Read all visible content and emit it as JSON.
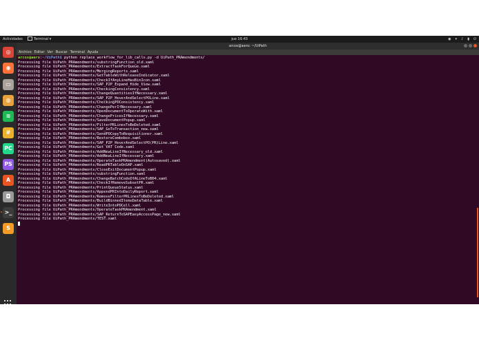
{
  "topbar": {
    "activities": "Actividades",
    "app_name": "Terminal",
    "app_menu_arrow": "▾",
    "clock": "jue 16:43",
    "status_icons": [
      "chrome-icon",
      "wifi-icon",
      "volume-icon",
      "battery-icon",
      "power-icon"
    ],
    "status_glyphs": [
      "◉",
      "▾",
      "♪",
      "▮",
      "⏻"
    ]
  },
  "window": {
    "title": "arcos@aero: ~/UiPath",
    "menu": [
      "Archivo",
      "Editar",
      "Ver",
      "Buscar",
      "Terminal",
      "Ayuda"
    ]
  },
  "terminal": {
    "prompt_user": "arcos@aero",
    "prompt_path": ":~/UiPath$",
    "command": " python replace_workflow_for_lib_calls.py -d UiPath_PRAmendments/",
    "lines": [
      "Processing file UiPath_PRAmendments/substringFunction_old.xaml",
      "Processing file UiPath_PRAmendments/ExtractTaskForQueue.xaml",
      "Processing file UiPath_PRAmendments/MergingReports.xaml",
      "Processing file UiPath_PRAmendments/GetTableWithReleaseIndicator.xaml",
      "Processing file UiPath_PRAmendments/CheckIfAnyLineHasBinIcon.xaml",
      "Processing file UiPath_PRAmendments/SAP_P2P_Expand_Hide_View.xaml",
      "Processing file UiPath_PRAmendments/CheckingConsistency.xaml",
      "Processing file UiPath_PRAmendments/ChangeQuantitiesIfNecessary.xaml",
      "Processing file UiPath_PRAmendments/SAP_P2P_HoverAndSelectPOLine.xaml",
      "Processing file UiPath_PRAmendments/CheckingPOConsistency.xaml",
      "Processing file UiPath_PRAmendments/ChangePerIfNecessary.xaml",
      "Processing file UiPath_PRAmendments/OpenDocumentToOperateWith.xaml",
      "Processing file UiPath_PRAmendments/ChangePricesIfNecessary.xaml",
      "Processing file UiPath_PRAmendments/SaveDocumentPopup.xaml",
      "Processing file UiPath_PRAmendments/FilterPRLinesToBeDeleted.xaml",
      "Processing file UiPath_PRAmendments/SAP_GoToTransaction_new.xaml",
      "Processing file UiPath_PRAmendments/SendPOCopyToRequisitioner.xaml",
      "Processing file UiPath_PRAmendments/RestoreCombobox.xaml",
      "Processing file UiPath_PRAmendments/SAP_P2P_HoverAndSelectPO(PR)Line.xaml",
      "Processing file UiPath_PRAmendments/Get VAT Code.xaml",
      "Processing file UiPath_PRAmendments/AddNewLineIfNecessary_old.xaml",
      "Processing file UiPath_PRAmendments/AddNewLineIfNecessary.xaml",
      "Processing file UiPath_PRAmendments/OperateTaskPRAmendment(Autosaved).xaml",
      "Processing file UiPath_PRAmendments/ReadPRTableOnSAP.xaml",
      "Processing file UiPath_PRAmendments/CloseExitDocumentPopup.xaml",
      "Processing file UiPath_PRAmendments/substringFunction.xaml",
      "Processing file UiPath_PRAmendments/ChangeBatchCodeOfALineToB04.xaml",
      "Processing file UiPath_PRAmendments/CheckIfRemoveSubsetPR.xaml",
      "Processing file UiPath_PRAmendments/PrintQueueStatus.xaml",
      "Processing file UiPath_PRAmendments/AppendPRIntoDailyReport.xaml",
      "Processing file UiPath_PRAmendments/RemoveFilterPRLinesToBeDeleted.xaml",
      "Processing file UiPath_PRAmendments/BuildBinnedItemsDataTable.xaml",
      "Processing file UiPath_PRAmendments/WriteIntoPOCell.xaml",
      "Processing file UiPath_PRAmendments/OperateTaskPRAmendment.xaml",
      "Processing file UiPath_PRAmendments/SAP_ReturnToSAPEasyAccessPage_new.xaml",
      "Processing file UiPath_PRAmendments/TEST.xaml"
    ]
  },
  "dock": [
    {
      "name": "chrome-icon",
      "glyph": "◎",
      "color": "#db4437"
    },
    {
      "name": "firefox-icon",
      "glyph": "◉",
      "color": "#ff7139"
    },
    {
      "name": "files-icon",
      "glyph": "▭",
      "color": "#a8a29b"
    },
    {
      "name": "rhythmbox-icon",
      "glyph": "◍",
      "color": "#e8a33d"
    },
    {
      "name": "spotify-icon",
      "glyph": "≋",
      "color": "#1db954"
    },
    {
      "name": "slack-icon",
      "glyph": "#",
      "color": "#ecb22e"
    },
    {
      "name": "pycharm-icon",
      "glyph": "PC",
      "color": "#21d789"
    },
    {
      "name": "phpstorm-icon",
      "glyph": "PS",
      "color": "#8f59e5"
    },
    {
      "name": "software-center-icon",
      "glyph": "A",
      "color": "#e95420"
    },
    {
      "name": "screenshot-icon",
      "glyph": "◘",
      "color": "#9a9a9a"
    },
    {
      "name": "terminal-icon",
      "glyph": ">_",
      "color": "#3c3c3c"
    },
    {
      "name": "sublime-text-icon",
      "glyph": "S",
      "color": "#f49a27"
    }
  ],
  "colors": {
    "terminal_bg": "#300a24",
    "prompt_user": "#8ae234",
    "prompt_path": "#729fcf",
    "accent": "#e95420"
  }
}
